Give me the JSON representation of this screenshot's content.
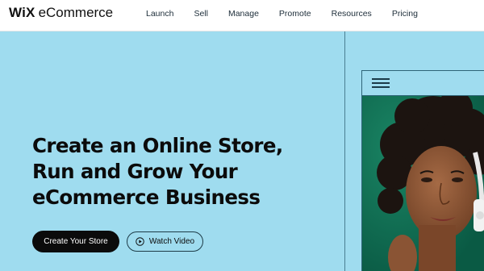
{
  "header": {
    "logo_wix": "WiX",
    "logo_product": "eCommerce",
    "nav": [
      "Launch",
      "Sell",
      "Manage",
      "Promote",
      "Resources",
      "Pricing"
    ]
  },
  "hero": {
    "headline": [
      "Create an Online Store,",
      "Run and Grow Your",
      "eCommerce Business"
    ],
    "primary_cta": "Create Your Store",
    "secondary_cta": "Watch Video"
  },
  "mockup": {
    "menu_icon": "hamburger-menu-icon",
    "image": "woman-with-headphones-photo"
  },
  "colors": {
    "hero_bg": "#9fdcef",
    "primary_button": "#0b0b0b",
    "photo_bg": "#0f6b52",
    "text": "#0b0b0b"
  }
}
